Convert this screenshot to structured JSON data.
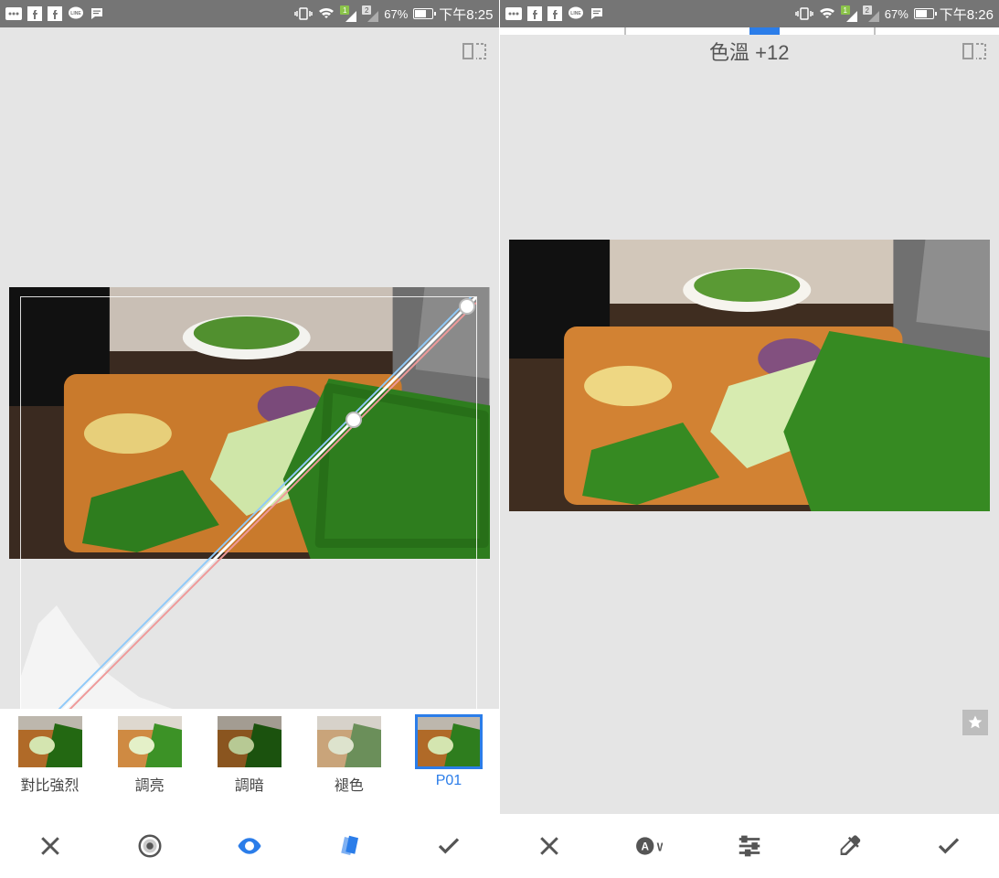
{
  "left": {
    "status": {
      "battery_pct": "67%",
      "time": "下午8:25"
    },
    "presets": [
      "對比強烈",
      "調亮",
      "調暗",
      "褪色",
      "P01"
    ],
    "selected_preset_index": 4,
    "tools": [
      "close",
      "contrast",
      "eye",
      "cards",
      "confirm"
    ],
    "active_tool_index": 2,
    "compare_icon": "compare-icon"
  },
  "right": {
    "status": {
      "battery_pct": "67%",
      "time": "下午8:26"
    },
    "adjust_label": "色溫 +12",
    "slider_value": 12,
    "tools": [
      "close",
      "auto-wb",
      "sliders",
      "eyedropper",
      "confirm"
    ],
    "compare_icon": "compare-icon"
  },
  "colors": {
    "accent": "#2b7de9",
    "statusbar": "#757575",
    "canvas": "#e5e5e5"
  }
}
